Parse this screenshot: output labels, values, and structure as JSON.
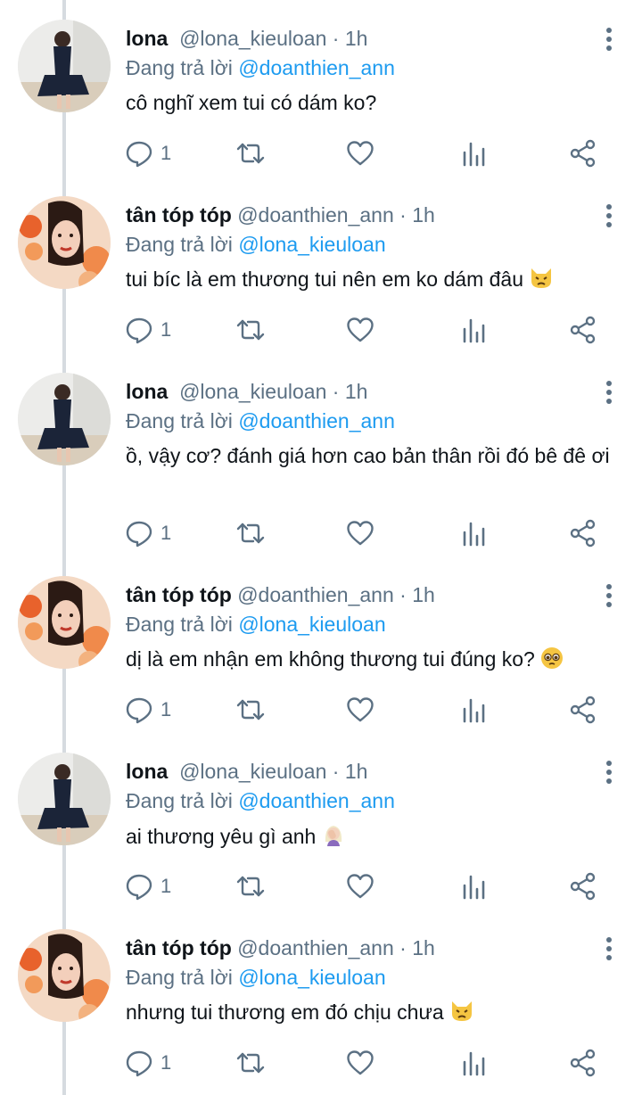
{
  "reply_prefix": "Đang trả lời",
  "colors": {
    "text": "#0f1419",
    "secondary": "#5b7083",
    "link": "#1d9bf0",
    "thread_line": "#d6dbe0"
  },
  "icons": [
    "reply-icon",
    "retweet-icon",
    "like-icon",
    "analytics-icon",
    "share-icon",
    "more-icon"
  ],
  "tweets": [
    {
      "name": "lona",
      "handle": "@lona_kieuloan",
      "dot": "·",
      "time": "1h",
      "replying_to": "@doanthien_ann",
      "text": "cô nghĩ xem tui có dám ko?",
      "emoji": "",
      "reply_count": "1"
    },
    {
      "name": "tân tóp tóp",
      "handle": "@doanthien_ann",
      "dot": "·",
      "time": "1h",
      "replying_to": "@lona_kieuloan",
      "text": "tui bíc là em thương tui nên em ko dám đâu",
      "emoji": "pouting-cat",
      "reply_count": "1"
    },
    {
      "name": "lona",
      "handle": "@lona_kieuloan",
      "dot": "·",
      "time": "1h",
      "replying_to": "@doanthien_ann",
      "text": "ồ, vậy cơ? đánh giá hơn cao bản thân rồi đó bê đê ơi",
      "emoji": "",
      "reply_count": "1"
    },
    {
      "name": "tân tóp tóp",
      "handle": "@doanthien_ann",
      "dot": "·",
      "time": "1h",
      "replying_to": "@lona_kieuloan",
      "text": "dị là em nhận em không thương tui đúng ko?",
      "emoji": "pleading-face",
      "reply_count": "1"
    },
    {
      "name": "lona",
      "handle": "@lona_kieuloan",
      "dot": "·",
      "time": "1h",
      "replying_to": "@doanthien_ann",
      "text": "ai thương yêu gì anh",
      "emoji": "woman-facepalming",
      "reply_count": "1"
    },
    {
      "name": "tân tóp tóp",
      "handle": "@doanthien_ann",
      "dot": "·",
      "time": "1h",
      "replying_to": "@lona_kieuloan",
      "text": "nhưng tui thương em đó chịu chưa",
      "emoji": "pouting-cat",
      "reply_count": "1"
    }
  ]
}
